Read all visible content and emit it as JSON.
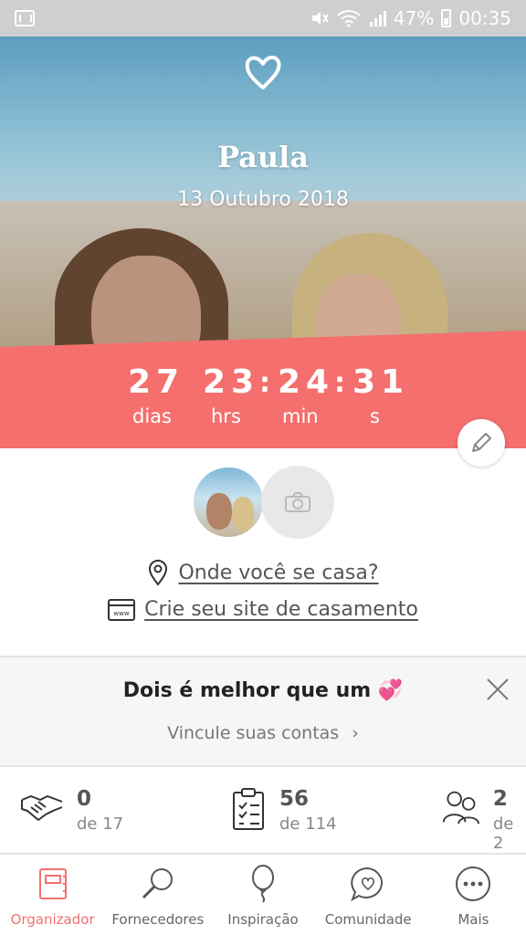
{
  "status_bar": {
    "battery": "47%",
    "time": "00:35"
  },
  "hero": {
    "couple_name": "Paula",
    "wedding_date": "13 Outubro 2018"
  },
  "countdown": {
    "days": "27",
    "hours": "23",
    "minutes": "24",
    "seconds": "31",
    "days_label": "dias",
    "hours_label": "hrs",
    "minutes_label": "min",
    "seconds_label": "s",
    "separator": ":"
  },
  "links": {
    "location": "Onde você se casa?",
    "website": "Crie seu site de casamento"
  },
  "promo": {
    "title": "Dois é melhor que um 💞",
    "link": "Vincule suas contas"
  },
  "stats": [
    {
      "value": "0",
      "sub": "de 17",
      "icon": "handshake-icon"
    },
    {
      "value": "56",
      "sub": "de 114",
      "icon": "checklist-icon"
    },
    {
      "value": "2",
      "sub": "de 2",
      "icon": "guests-icon"
    }
  ],
  "nav": [
    {
      "label": "Organizador",
      "icon": "notebook-icon",
      "active": true
    },
    {
      "label": "Fornecedores",
      "icon": "search-icon",
      "active": false
    },
    {
      "label": "Inspiração",
      "icon": "balloon-icon",
      "active": false
    },
    {
      "label": "Comunidade",
      "icon": "chat-heart-icon",
      "active": false
    },
    {
      "label": "Mais",
      "icon": "more-icon",
      "active": false
    }
  ],
  "colors": {
    "accent": "#f46f6d"
  }
}
